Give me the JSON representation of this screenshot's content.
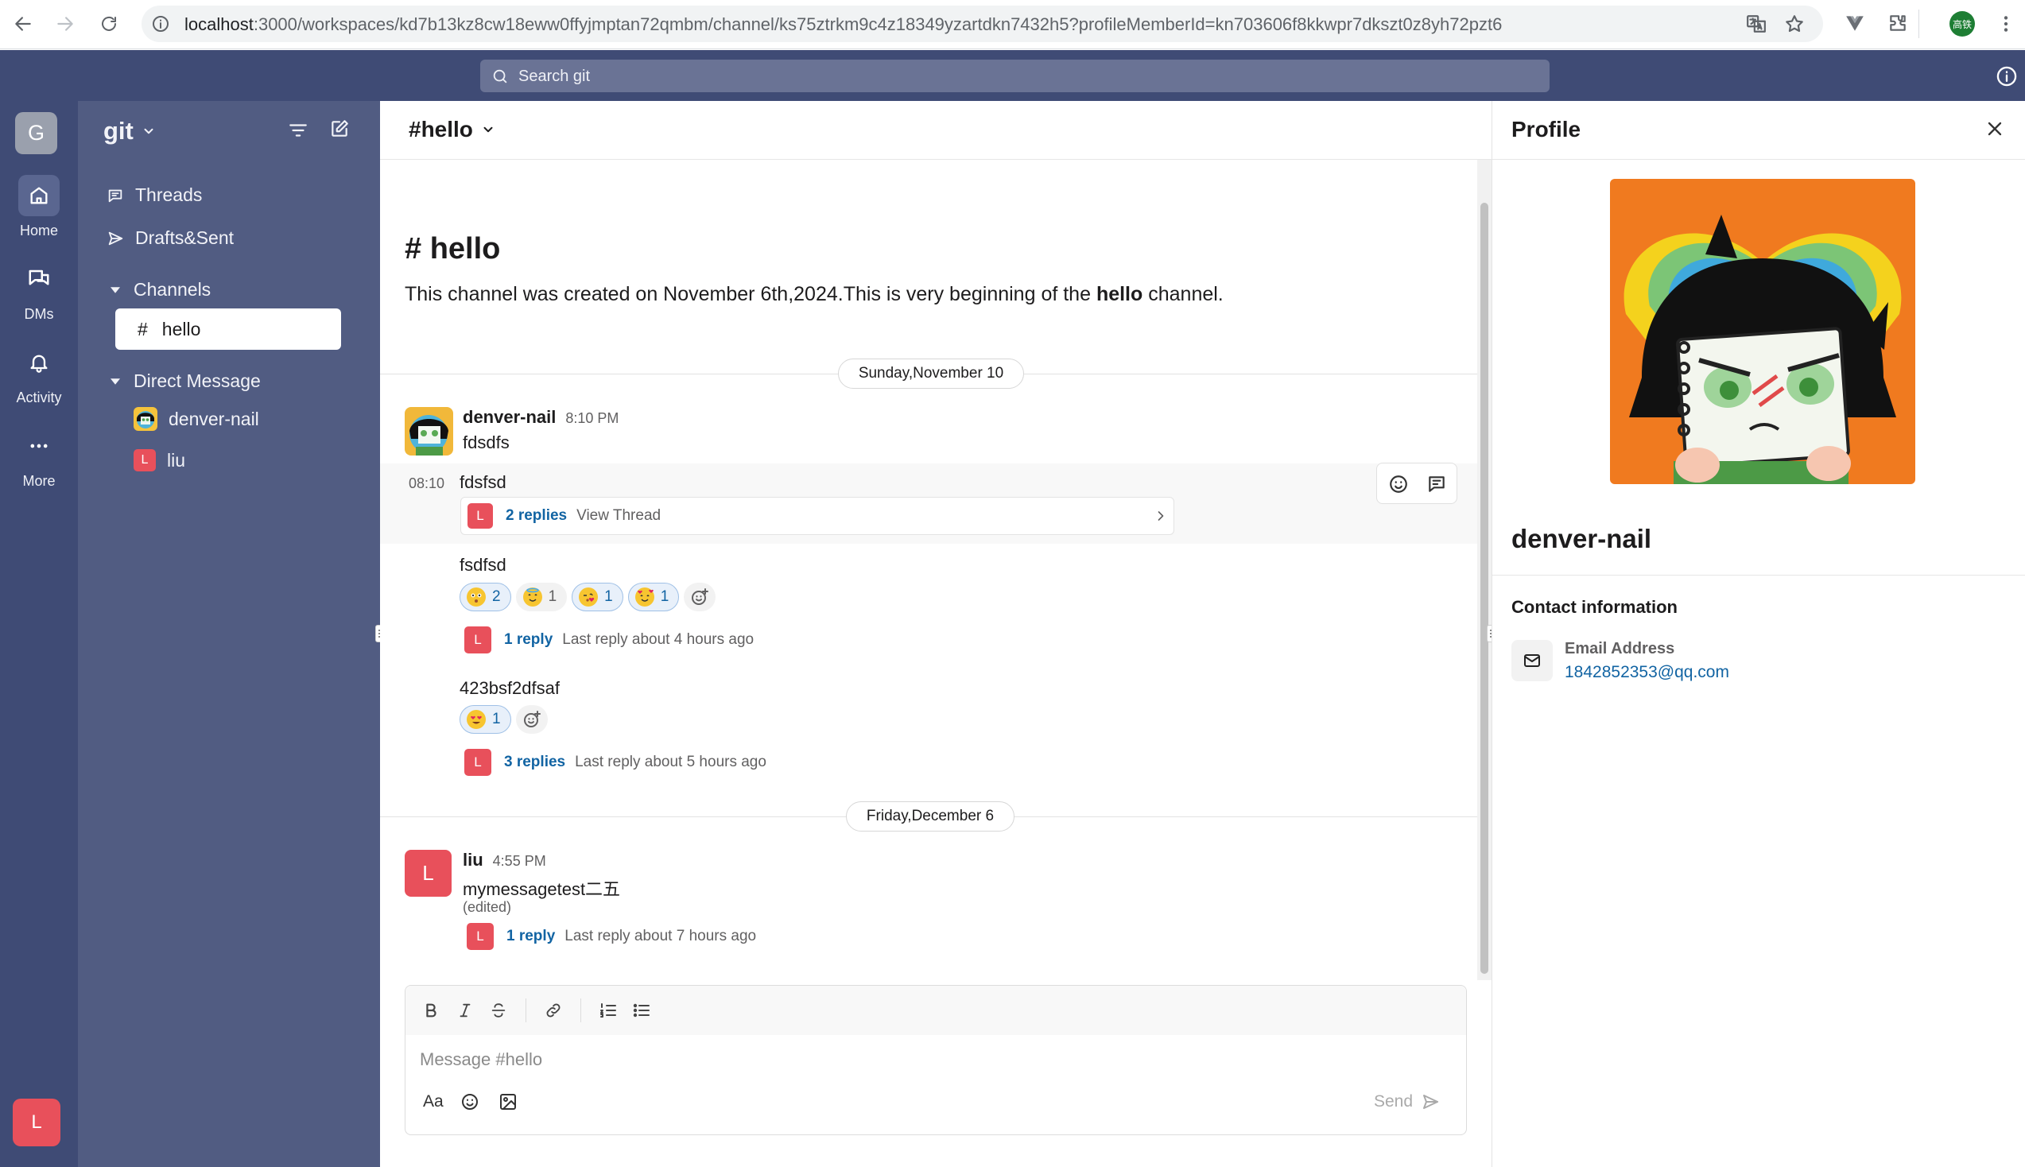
{
  "browser": {
    "url_host": "localhost",
    "url_rest": ":3000/workspaces/kd7b13kz8cw18eww0ffyjmptan72qmbm/channel/ks75ztrkm9c4z18349yzartdkn7432h5?profileMemberId=kn703606f8kkwpr7dkszt0z8yh72pzt6",
    "avatar_text": "高铁"
  },
  "topbar": {
    "search_placeholder": "Search git"
  },
  "rail": {
    "workspace_initial": "G",
    "items": [
      {
        "label": "Home",
        "icon": "home-icon"
      },
      {
        "label": "DMs",
        "icon": "dms-icon"
      },
      {
        "label": "Activity",
        "icon": "bell-icon"
      },
      {
        "label": "More",
        "icon": "more-icon"
      }
    ],
    "user_initial": "L"
  },
  "sidebar": {
    "workspace_name": "git",
    "threads_label": "Threads",
    "drafts_label": "Drafts&Sent",
    "channels_label": "Channels",
    "channel_hash": "#",
    "channel_name": "hello",
    "dm_label": "Direct Message",
    "dms": [
      {
        "name": "denver-nail"
      },
      {
        "name": "liu",
        "initial": "L"
      }
    ]
  },
  "channel": {
    "header": "#hello",
    "intro_title": "# hello",
    "intro_pre": "This channel was created on November 6th,2024.This is very beginning of the ",
    "intro_bold": "hello",
    "intro_post": " channel.",
    "date1": "Sunday,November 10",
    "date2": "Friday,December 6",
    "messages": [
      {
        "sender": "denver-nail",
        "time": "8:10 PM",
        "text": "fdsdfs"
      },
      {
        "hover_time": "08:10",
        "text": "fdsfsd",
        "reply_initial": "L",
        "reply_count": "2 replies",
        "reply_meta": "View Thread"
      },
      {
        "text": "fsdfsd",
        "reactions": [
          "2",
          "1",
          "1",
          "1"
        ],
        "reply_initial": "L",
        "reply_count": "1 reply",
        "reply_meta": "Last reply about 4 hours ago"
      },
      {
        "text": "423bsf2dfsaf",
        "reactions": [
          "1"
        ],
        "reply_initial": "L",
        "reply_count": "3 replies",
        "reply_meta": "Last reply about 5 hours ago"
      },
      {
        "sender": "liu",
        "initial": "L",
        "time": "4:55 PM",
        "text": "mymessagetest二五",
        "edited": "(edited)",
        "reply_initial": "L",
        "reply_count": "1 reply",
        "reply_meta": "Last reply about 7 hours ago"
      }
    ]
  },
  "composer": {
    "placeholder": "Message #hello",
    "format_label": "Aa",
    "send_label": "Send"
  },
  "profile": {
    "title": "Profile",
    "name": "denver-nail",
    "contact_heading": "Contact information",
    "email_label": "Email Address",
    "email": "1842852353@qq.com"
  },
  "colors": {
    "rail_bg": "#3f4b75",
    "sidebar_bg": "#515c82",
    "link": "#1264a3",
    "avatar_red": "#e8505b"
  }
}
